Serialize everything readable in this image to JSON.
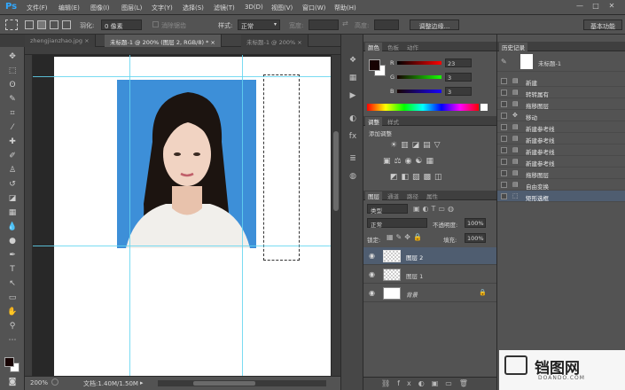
{
  "menubar": {
    "logo": "Ps",
    "items": [
      "文件(F)",
      "编辑(E)",
      "图像(I)",
      "图层(L)",
      "文字(Y)",
      "选择(S)",
      "滤镜(T)",
      "3D(D)",
      "视图(V)",
      "窗口(W)",
      "帮助(H)"
    ],
    "window_buttons": [
      "—",
      "□",
      "✕"
    ]
  },
  "options": {
    "feather_label": "羽化:",
    "feather_value": "0 像素",
    "antialias_label": "消除锯齿",
    "style_label": "样式:",
    "style_value": "正常",
    "width_label": "宽度:",
    "height_label": "高度:",
    "refine_button": "调整边缘...",
    "workspace_button": "基本功能"
  },
  "tabs": [
    {
      "label": "zhengjianzhao.jpg"
    },
    {
      "label": "未标题-1 @ 200% (图层 2, RGB/8) *"
    },
    {
      "label": "未标题-1 @ 200%"
    }
  ],
  "status": {
    "zoom": "200%",
    "doc_info": "文档:1.40M/1.50M"
  },
  "color_panel": {
    "tabs": [
      "颜色",
      "色板",
      "动作"
    ],
    "r_label": "R",
    "r_value": "23",
    "g_label": "G",
    "g_value": "3",
    "b_label": "B",
    "b_value": "3",
    "foreground": "#170303",
    "background": "#ffffff"
  },
  "adjust_panel": {
    "tabs": [
      "调整",
      "样式"
    ],
    "title": "添加调整"
  },
  "layers_panel": {
    "tabs": [
      "图层",
      "通道",
      "路径",
      "属性"
    ],
    "filter_value": "类型",
    "blend_mode": "正常",
    "opacity_label": "不透明度:",
    "opacity_value": "100%",
    "lock_label": "锁定:",
    "fill_label": "填充:",
    "fill_value": "100%",
    "layers": [
      {
        "name": "图层 2"
      },
      {
        "name": "图层 1"
      },
      {
        "name": "背景"
      }
    ]
  },
  "history_panel": {
    "tab": "历史记录",
    "snapshot": "未标题-1",
    "items": [
      "新建",
      "转转属有",
      "拖移图层",
      "移动",
      "新建参考线",
      "新建参考线",
      "新建参考线",
      "新建参考线",
      "拖移图层",
      "自由变换",
      "矩形选框"
    ]
  },
  "watermark": {
    "title": "铛图网",
    "subtitle": "DOANDO.COM"
  },
  "colors": {
    "accent": "#31a8ff",
    "photo_bg": "#3d8fd8",
    "guide": "#62d5f0",
    "selected_row": "#4f5d70"
  }
}
